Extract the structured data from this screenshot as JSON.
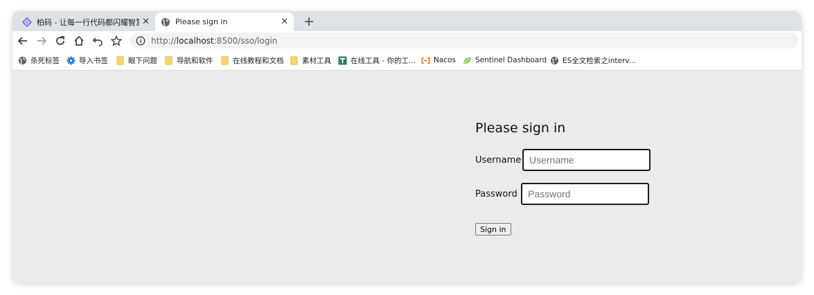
{
  "tabs": [
    {
      "title": "柏码 - 让每一行代码都闪耀智慧的光芒",
      "close": "✕"
    },
    {
      "title": "Please sign in",
      "close": "✕"
    }
  ],
  "new_tab": "+",
  "toolbar": {
    "url_scheme": "http://",
    "url_host": "localhost",
    "url_path": ":8500/sso/login"
  },
  "bookmarks": [
    {
      "label": "杀死标签",
      "icon": "globe-icon"
    },
    {
      "label": "导入书签",
      "icon": "gear-icon"
    },
    {
      "label": "眼下问题",
      "icon": "folder-icon"
    },
    {
      "label": "导航和软件",
      "icon": "folder-icon"
    },
    {
      "label": "在线教程和文档",
      "icon": "folder-icon"
    },
    {
      "label": "素材工具",
      "icon": "folder-icon"
    },
    {
      "label": "在线工具 - 你的工...",
      "icon": "tool-icon"
    },
    {
      "label": "Nacos",
      "icon": "nacos-icon"
    },
    {
      "label": "Sentinel Dashboard",
      "icon": "leaf-icon"
    },
    {
      "label": "ES全文检索之interv...",
      "icon": "globe-icon"
    }
  ],
  "colors": {
    "tab_strip": "#dee1e6",
    "folder": "#f9d66b",
    "gear": "#1a73e8",
    "tool": "#2e7d55",
    "nacos": "#e8761a",
    "leaf": "#8bc34a",
    "page_bg": "#ebebeb"
  },
  "form": {
    "title": "Please sign in",
    "username_label": "Username",
    "username_placeholder": "Username",
    "password_label": "Password",
    "password_placeholder": "Password",
    "submit_label": "Sign in"
  }
}
